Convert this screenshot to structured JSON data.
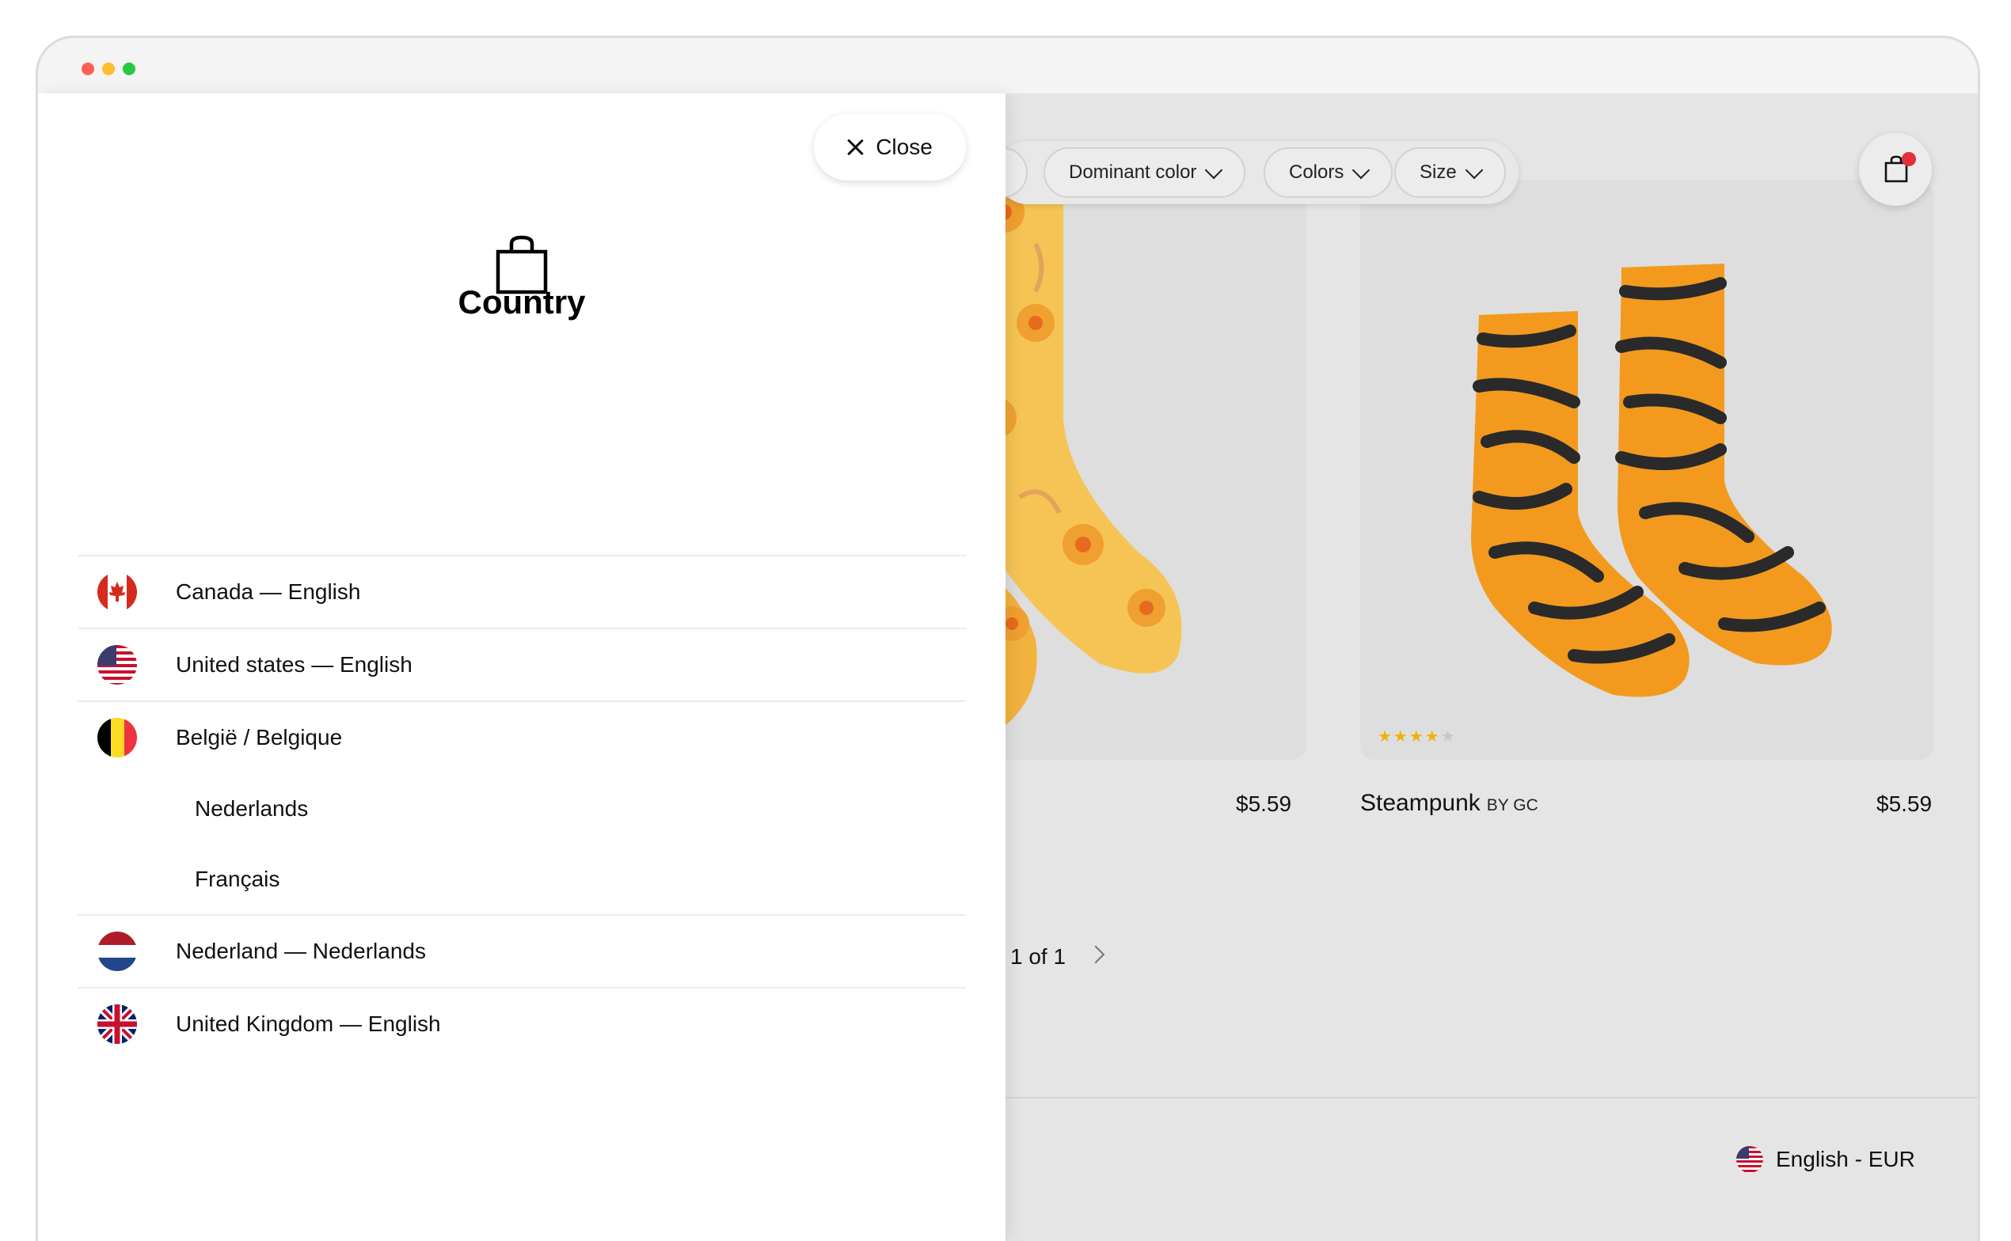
{
  "drawer": {
    "close_label": "Close",
    "title": "Country",
    "countries": [
      {
        "label": "Canada — English",
        "flag": "canada-flag-icon"
      },
      {
        "label": "United states — English",
        "flag": "us-flag-icon"
      },
      {
        "label": "België / Belgique",
        "flag": "belgium-flag-icon",
        "languages": [
          "Nederlands",
          "Français"
        ]
      },
      {
        "label": "Nederland — Nederlands",
        "flag": "netherlands-flag-icon"
      },
      {
        "label": "United Kingdom — English",
        "flag": "uk-flag-icon"
      }
    ]
  },
  "store": {
    "filters": [
      "Dominant color",
      "Colors",
      "Size"
    ],
    "products": [
      {
        "price": "$5.59"
      },
      {
        "name": "Steampunk",
        "brand": "BY GC",
        "price": "$5.59",
        "rating": 3.5
      }
    ],
    "pagination": "1 of 1",
    "locale": "English - EUR",
    "colors": {
      "cart_badge": "#e0323c",
      "star": "#f0b400",
      "sock_orange": "#f39a1e",
      "sock_yellow": "#f6c23e"
    }
  }
}
